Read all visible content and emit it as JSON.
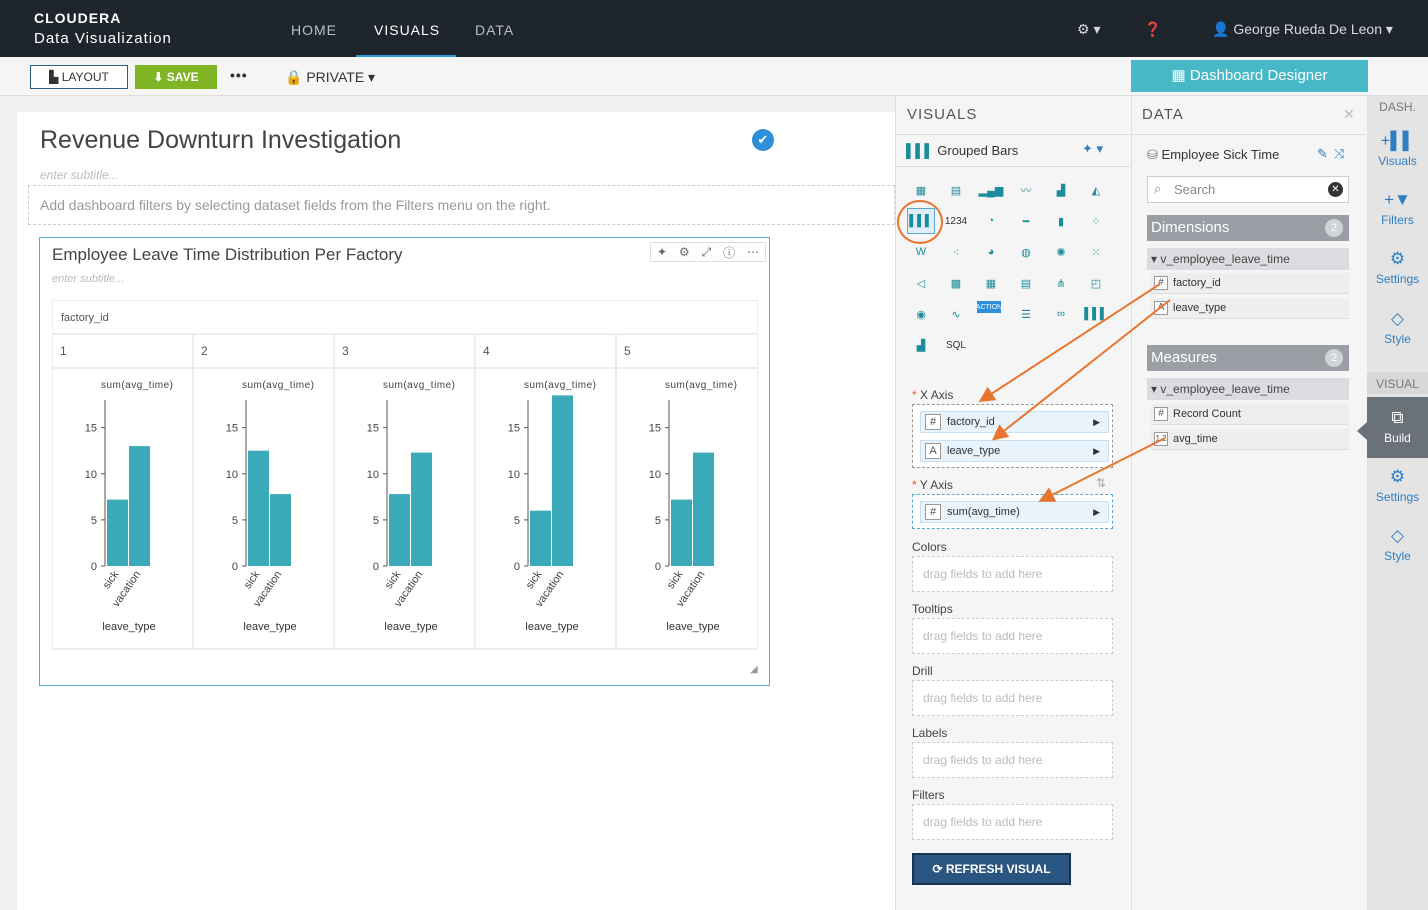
{
  "header": {
    "brand_line1": "CLOUDERA",
    "brand_line2": "Data Visualization",
    "nav": [
      "HOME",
      "VISUALS",
      "DATA"
    ],
    "user": "George Rueda De Leon"
  },
  "toolbar": {
    "layout": "LAYOUT",
    "save": "SAVE",
    "more": "•••",
    "privacy": "PRIVATE",
    "designer": "Dashboard Designer"
  },
  "dashboard": {
    "title": "Revenue Downturn Investigation",
    "subtitle_placeholder": "enter subtitle...",
    "filter_hint": "Add dashboard filters by selecting dataset fields from the Filters menu on the right."
  },
  "visual": {
    "title": "Employee Leave Time Distribution Per Factory",
    "subtitle_placeholder": "enter subtitle...",
    "facet_header": "factory_id"
  },
  "chart_data": {
    "type": "bar",
    "facet_field": "factory_id",
    "facets": [
      "1",
      "2",
      "3",
      "4",
      "5"
    ],
    "categories": [
      "sick",
      "vacation"
    ],
    "xlabel": "leave_type",
    "ylabel": "sum(avg_time)",
    "yticks": [
      0,
      5,
      10,
      15
    ],
    "values": [
      [
        7.2,
        13
      ],
      [
        12.5,
        7.8
      ],
      [
        7.8,
        12.3
      ],
      [
        6,
        18.5
      ],
      [
        7.2,
        12.3
      ]
    ]
  },
  "visuals_panel": {
    "header": "VISUALS",
    "selected_type": "Grouped Bars",
    "x_axis_label": "X Axis",
    "x_axis_fields": [
      "factory_id",
      "leave_type"
    ],
    "y_axis_label": "Y Axis",
    "y_axis_fields": [
      "sum(avg_time)"
    ],
    "shelves": [
      "Colors",
      "Tooltips",
      "Drill",
      "Labels",
      "Filters"
    ],
    "shelf_placeholder": "drag fields to add here",
    "refresh": "REFRESH VISUAL",
    "icon_text_sql": "SQL",
    "icon_text_label": "1234",
    "icon_text_action": "ACTION"
  },
  "data_panel": {
    "header": "DATA",
    "dataset": "Employee Sick Time",
    "search_placeholder": "Search",
    "dimensions": {
      "label": "Dimensions",
      "count": "2",
      "group": "v_employee_leave_time",
      "fields": [
        "factory_id",
        "leave_type"
      ]
    },
    "measures": {
      "label": "Measures",
      "count": "2",
      "group": "v_employee_leave_time",
      "fields": [
        "Record Count",
        "avg_time"
      ]
    }
  },
  "sidebar": {
    "dash_header": "DASH.",
    "dash_items": [
      "Visuals",
      "Filters",
      "Settings",
      "Style"
    ],
    "visual_header": "VISUAL",
    "visual_items": [
      "Build",
      "Settings",
      "Style"
    ]
  },
  "colors": {
    "bar": "#3aaab9",
    "annotation": "#e8752f",
    "accent": "#2e9bd6"
  }
}
